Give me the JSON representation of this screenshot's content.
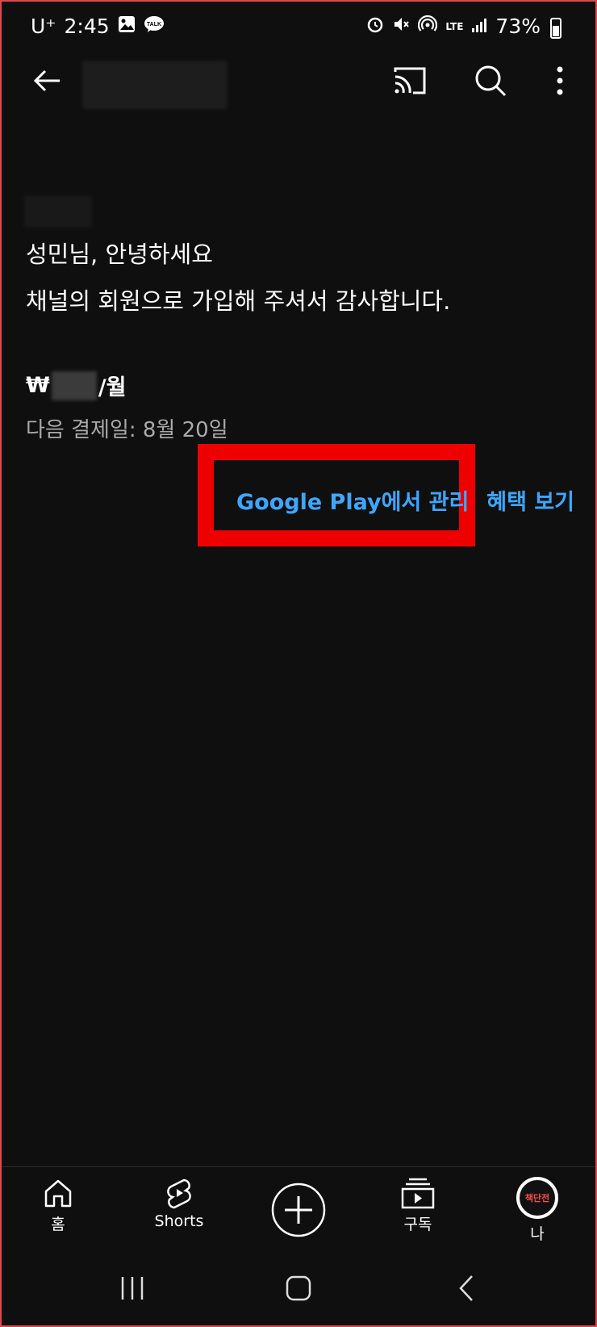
{
  "status_bar": {
    "carrier": "U⁺",
    "time": "2:45",
    "network": "LTE",
    "battery": "73%",
    "icons": [
      "image-icon",
      "kakaotalk-icon",
      "alarm-icon",
      "mute-icon",
      "hotspot-icon",
      "signal-icon",
      "battery-icon"
    ]
  },
  "topbar": {
    "icons": [
      "back-arrow-icon",
      "cast-icon",
      "search-icon",
      "more-vert-icon"
    ]
  },
  "membership": {
    "greeting": "성민님, 안녕하세요",
    "thanks": "채널의 회원으로 가입해 주셔서 감사합니다.",
    "price_prefix": "₩",
    "price_suffix": "/월",
    "next_payment": "다음 결제일: 8월 20일",
    "manage_label": "Google Play에서 관리",
    "benefits_label": "혜택 보기"
  },
  "highlight_color": "#ee0000",
  "link_color": "#3ea6ff",
  "bottom_nav": {
    "home": "홈",
    "shorts": "Shorts",
    "subscriptions": "구독",
    "me": "나",
    "avatar_text": "책단전"
  }
}
